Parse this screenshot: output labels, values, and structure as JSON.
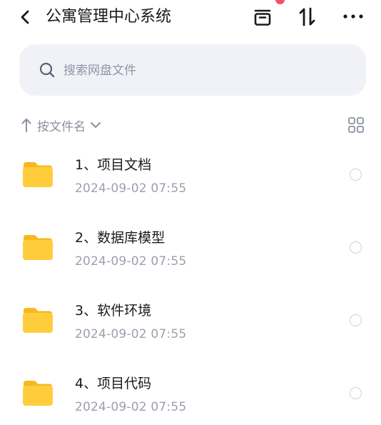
{
  "header": {
    "title": "公寓管理中心系统",
    "icons": {
      "back": "chevron-left-icon",
      "archive": "archive-box-icon",
      "sort": "swap-vertical-icon",
      "more": "more-horizontal-icon"
    },
    "notification_color": "#f0506e"
  },
  "search": {
    "placeholder": "搜索网盘文件",
    "value": ""
  },
  "sort": {
    "label": "按文件名",
    "direction": "ascending"
  },
  "view_toggle": "grid-view-icon",
  "files": [
    {
      "name": "1、项目文档",
      "date": "2024-09-02  07:55",
      "type": "folder",
      "selected": false
    },
    {
      "name": "2、数据库模型",
      "date": "2024-09-02  07:55",
      "type": "folder",
      "selected": false
    },
    {
      "name": "3、软件环境",
      "date": "2024-09-02  07:55",
      "type": "folder",
      "selected": false
    },
    {
      "name": "4、项目代码",
      "date": "2024-09-02  07:55",
      "type": "folder",
      "selected": false
    }
  ],
  "colors": {
    "folder": "#ffc933",
    "search_bg": "#f1f2f8",
    "muted_text": "#9ba0ad"
  }
}
